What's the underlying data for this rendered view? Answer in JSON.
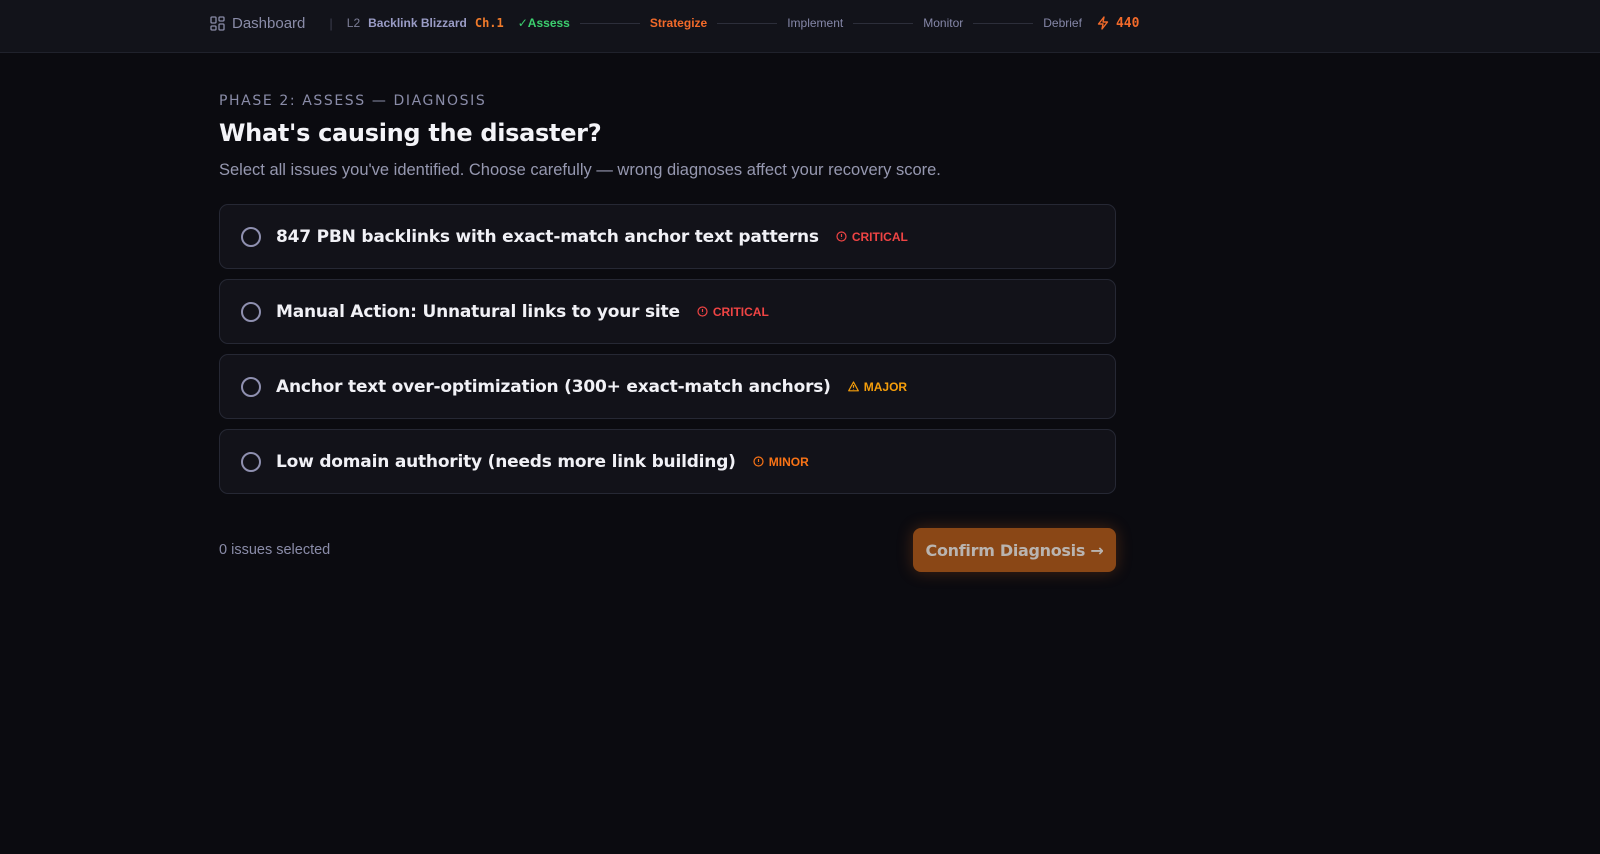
{
  "nav": {
    "dashboard_label": "Dashboard",
    "level": "L2",
    "mission": "Backlink Blizzard",
    "chapter": "Ch.1",
    "steps": [
      {
        "label": "✓Assess",
        "state": "done"
      },
      {
        "label": "Strategize",
        "state": "active"
      },
      {
        "label": "Implement",
        "state": "upcoming"
      },
      {
        "label": "Monitor",
        "state": "upcoming"
      },
      {
        "label": "Debrief",
        "state": "upcoming"
      }
    ],
    "xp": "440"
  },
  "header": {
    "phase": "PHASE 2: ASSESS — DIAGNOSIS",
    "title": "What's causing the disaster?",
    "subtitle": "Select all issues you've identified. Choose carefully — wrong diagnoses affect your recovery score."
  },
  "issues": [
    {
      "label": "847 PBN backlinks with exact-match anchor text patterns",
      "severity": "CRITICAL",
      "icon": "alert-circle-icon",
      "color": "#ef4444",
      "selected": false
    },
    {
      "label": "Manual Action: Unnatural links to your site",
      "severity": "CRITICAL",
      "icon": "alert-circle-icon",
      "color": "#ef4444",
      "selected": false
    },
    {
      "label": "Anchor text over-optimization (300+ exact-match anchors)",
      "severity": "MAJOR",
      "icon": "warning-triangle-icon",
      "color": "#f59e0b",
      "selected": false
    },
    {
      "label": "Low domain authority (needs more link building)",
      "severity": "MINOR",
      "icon": "alert-circle-icon",
      "color": "#f97316",
      "selected": false
    }
  ],
  "footer": {
    "count_text": "0 issues selected",
    "confirm_label": "Confirm Diagnosis →"
  },
  "colors": {
    "accent": "#f26a2a",
    "done": "#3ccf6e",
    "background": "#0b0b10"
  }
}
